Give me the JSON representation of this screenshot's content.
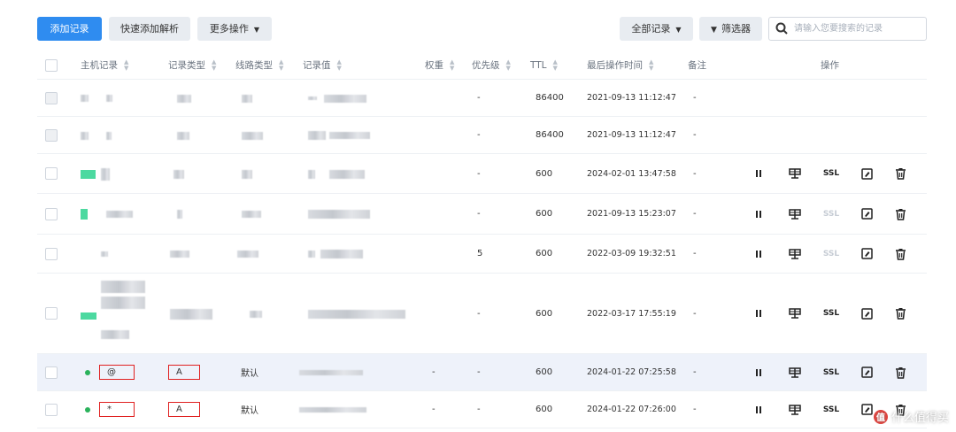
{
  "toolbar": {
    "add_record": "添加记录",
    "quick_add": "快速添加解析",
    "more_actions": "更多操作",
    "all_records": "全部记录",
    "filter": "筛选器",
    "search_placeholder": "请输入您要搜索的记录"
  },
  "columns": {
    "host": "主机记录",
    "type": "记录类型",
    "line": "线路类型",
    "value": "记录值",
    "weight": "权重",
    "priority": "优先级",
    "ttl": "TTL",
    "updated": "最后操作时间",
    "remark": "备注",
    "actions": "操作"
  },
  "rows": [
    {
      "weight": "",
      "priority": "-",
      "ttl": "86400",
      "updated": "2021-09-13 11:12:47",
      "remark": "-",
      "ops": false
    },
    {
      "weight": "",
      "priority": "-",
      "ttl": "86400",
      "updated": "2021-09-13 11:12:47",
      "remark": "-",
      "ops": false
    },
    {
      "weight": "",
      "priority": "-",
      "ttl": "600",
      "updated": "2024-02-01 13:47:58",
      "remark": "-",
      "ops": true,
      "ssl_enabled": true
    },
    {
      "weight": "",
      "priority": "-",
      "ttl": "600",
      "updated": "2021-09-13 15:23:07",
      "remark": "-",
      "ops": true,
      "ssl_enabled": false
    },
    {
      "weight": "",
      "priority": "5",
      "ttl": "600",
      "updated": "2022-03-09 19:32:51",
      "remark": "-",
      "ops": true,
      "ssl_enabled": false
    },
    {
      "weight": "",
      "priority": "-",
      "ttl": "600",
      "updated": "2022-03-17 17:55:19",
      "remark": "-",
      "ops": true,
      "ssl_enabled": true
    },
    {
      "host": "@",
      "type": "A",
      "line": "默认",
      "weight": "-",
      "priority": "-",
      "ttl": "600",
      "updated": "2024-01-22 07:25:58",
      "remark": "-",
      "ops": true,
      "ssl_enabled": true,
      "highlight": true
    },
    {
      "host": "*",
      "type": "A",
      "line": "默认",
      "weight": "-",
      "priority": "-",
      "ttl": "600",
      "updated": "2024-01-22 07:26:00",
      "remark": "-",
      "ops": true,
      "ssl_enabled": true
    }
  ],
  "actions": {
    "ssl_label": "SSL"
  },
  "watermark": {
    "text": "什么值得买",
    "badge": "值"
  }
}
